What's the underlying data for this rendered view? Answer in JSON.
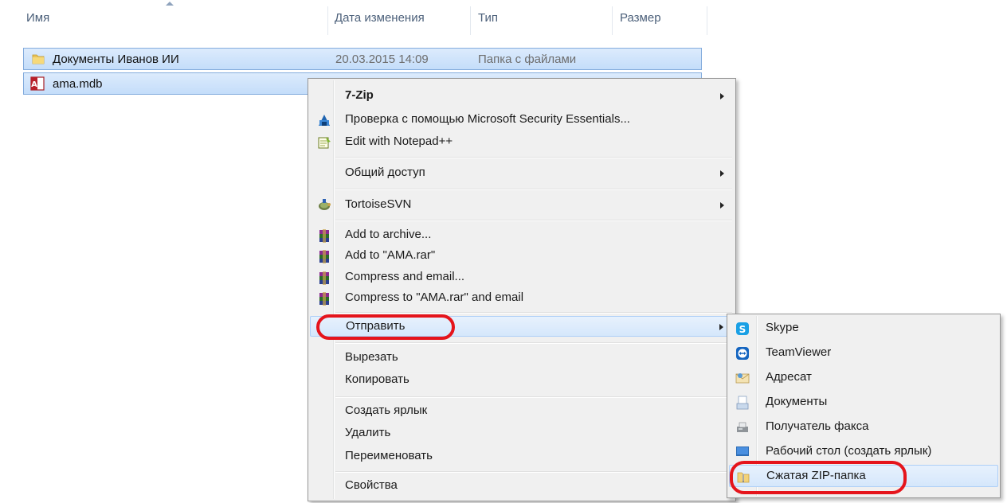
{
  "columns": {
    "name": "Имя",
    "date": "Дата изменения",
    "type": "Тип",
    "size": "Размер"
  },
  "files": [
    {
      "name": "Документы Иванов ИИ",
      "date": "20.03.2015 14:09",
      "type": "Папка с файлами",
      "icon": "folder-icon"
    },
    {
      "name": "ama.mdb",
      "icon": "access-file-icon"
    }
  ],
  "menu": {
    "items": [
      {
        "label": "7-Zip"
      },
      {
        "label": "Проверка с помощью Microsoft Security Essentials..."
      },
      {
        "label": "Edit with Notepad++"
      },
      {
        "label": "Общий доступ"
      },
      {
        "label": "TortoiseSVN"
      },
      {
        "label": "Add to archive..."
      },
      {
        "label": "Add to \"AMA.rar\""
      },
      {
        "label": "Compress and email..."
      },
      {
        "label": "Compress to \"AMA.rar\" and email"
      },
      {
        "label": "Отправить"
      },
      {
        "label": "Вырезать"
      },
      {
        "label": "Копировать"
      },
      {
        "label": "Создать ярлык"
      },
      {
        "label": "Удалить"
      },
      {
        "label": "Переименовать"
      },
      {
        "label": "Свойства"
      }
    ]
  },
  "submenu": {
    "items": [
      {
        "label": "Skype"
      },
      {
        "label": "TeamViewer"
      },
      {
        "label": "Адресат"
      },
      {
        "label": "Документы"
      },
      {
        "label": "Получатель факса"
      },
      {
        "label": "Рабочий стол (создать ярлык)"
      },
      {
        "label": "Сжатая ZIP-папка"
      }
    ]
  },
  "colors": {
    "selection": "#cde4fb",
    "highlight_circle": "#e5141b",
    "menu_background": "#f0f0f0"
  }
}
